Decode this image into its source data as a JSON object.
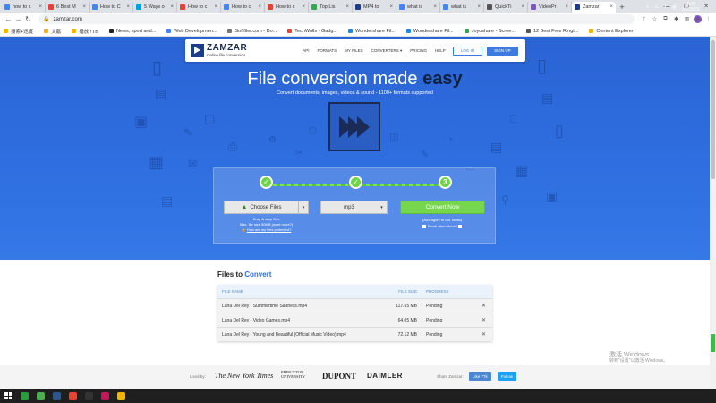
{
  "browser": {
    "tabs": [
      {
        "label": "how to c",
        "color": "#4285f4"
      },
      {
        "label": "6 Best M",
        "color": "#e94235"
      },
      {
        "label": "How to C",
        "color": "#4285f4"
      },
      {
        "label": "5 Ways o",
        "color": "#00a1e0"
      },
      {
        "label": "How to c",
        "color": "#e94235"
      },
      {
        "label": "How to c",
        "color": "#4285f4"
      },
      {
        "label": "How to c",
        "color": "#e94235"
      },
      {
        "label": "Top Lis",
        "color": "#34a853"
      },
      {
        "label": "MP4 to",
        "color": "#1e3c8c"
      },
      {
        "label": "what is",
        "color": "#4285f4"
      },
      {
        "label": "what is",
        "color": "#4285f4"
      },
      {
        "label": "QuickTi",
        "color": "#555555"
      },
      {
        "label": "VideoPr",
        "color": "#7e57c2"
      },
      {
        "label": "Zamzar",
        "color": "#1e3c8c",
        "active": true
      }
    ],
    "new_tab": "+",
    "url": "zamzar.com",
    "avatar_letter": "A",
    "bookmarks": [
      {
        "label": "搜索+迅度",
        "color": "#f4b400"
      },
      {
        "label": "文献",
        "color": "#f4b400"
      },
      {
        "label": "播放YTB",
        "color": "#f4b400"
      },
      {
        "label": "News, sport and...",
        "color": "#222222"
      },
      {
        "label": "Web Developmen...",
        "color": "#4285f4"
      },
      {
        "label": "Softfiler.com - Do...",
        "color": "#777777"
      },
      {
        "label": "TechWalls - Gadg...",
        "color": "#e94235"
      },
      {
        "label": "Wondershare Fil...",
        "color": "#1e88e5"
      },
      {
        "label": "Wondershare Fil...",
        "color": "#1e88e5"
      },
      {
        "label": "Joyoshare - Scree...",
        "color": "#34a853"
      },
      {
        "label": "12 Best Free Ringt...",
        "color": "#555555"
      },
      {
        "label": "Content Explorer",
        "color": "#f4b400"
      }
    ]
  },
  "site": {
    "brand": "ZAMZAR",
    "tagline": "Online file conversion",
    "nav": [
      "API",
      "FORMATS",
      "MY FILES",
      "CONVERTERS ▾",
      "PRICING",
      "HELP"
    ],
    "login": "LOG IN",
    "signup": "SIGN UP",
    "headline_main": "File conversion made ",
    "headline_em": "easy",
    "subline": "Convert documents, images, videos & sound - 1100+ formats supported"
  },
  "converter": {
    "steps": [
      "✓",
      "✓",
      "3"
    ],
    "choose_files": "Choose Files",
    "format": "mp3",
    "convert_now": "Convert Now",
    "hint_drag": "Drag & drop files",
    "hint_max": "Max. file size 50MB ",
    "hint_want_more": "(want more?)",
    "hint_protected": "How are my files protected?",
    "agree": "(And agree to our Terms)",
    "email_when_done": "Email when done?"
  },
  "files": {
    "title_prefix": "Files to ",
    "title_em": "Convert",
    "headers": {
      "name": "FILE NAME",
      "size": "FILE SIZE",
      "progress": "PROGRESS"
    },
    "rows": [
      {
        "name": "Lana Del Rey - Summertime Sadness.mp4",
        "size": "117.65 MB",
        "progress": "Pending"
      },
      {
        "name": "Lana Del Rey - Video Games.mp4",
        "size": "64.05 MB",
        "progress": "Pending"
      },
      {
        "name": "Lana Del Rey - Young and Beautiful (Official Music Video).mp4",
        "size": "72.12 MB",
        "progress": "Pending"
      }
    ]
  },
  "footer": {
    "used_by": "Used by:",
    "logos": [
      "The New York Times",
      "PRINCETON UNIVERSITY",
      "DUPONT",
      "DAIMLER"
    ],
    "share": "Share Zamzar:",
    "like": "Like 77k",
    "follow": "Follow"
  },
  "watermark": {
    "line1": "激活 Windows",
    "line2": "转到\"设置\"以激活 Windows。"
  },
  "taskbar": {
    "apps": [
      "#2b9b3b",
      "#4caf50",
      "#2b579a",
      "#ea4335",
      "#333333",
      "#c2185b",
      "#f5b400"
    ],
    "time": "15:31",
    "date": "2022/8/3"
  }
}
